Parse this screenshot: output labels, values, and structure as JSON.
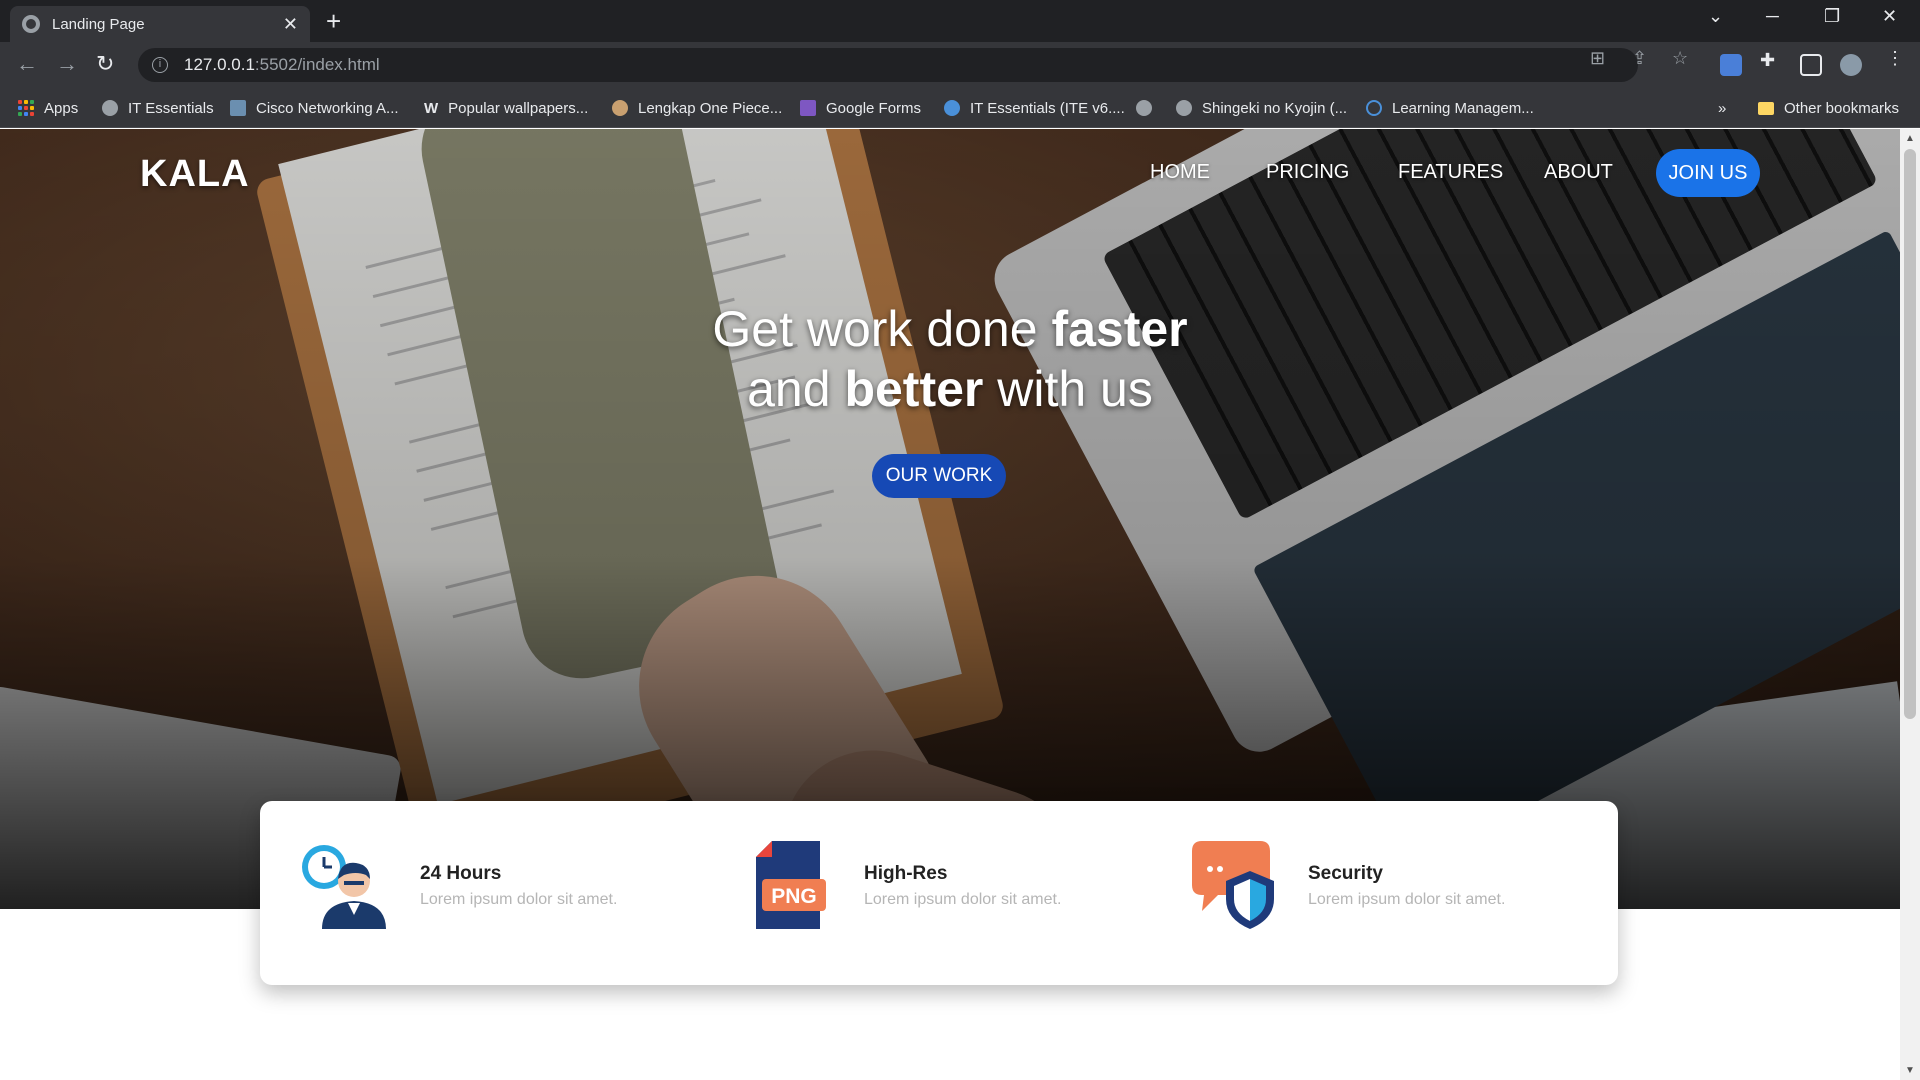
{
  "browser": {
    "tab_title": "Landing Page",
    "tab_close": "✕",
    "new_tab": "+",
    "url_host": "127.0.0.1",
    "url_path": ":5502/index.html",
    "bookmarks": [
      {
        "label": "Apps",
        "icon": "apps-grid-icon"
      },
      {
        "label": "IT Essentials",
        "icon": "globe-icon"
      },
      {
        "label": "Cisco Networking A...",
        "icon": "cisco-icon"
      },
      {
        "label": "Popular wallpapers...",
        "icon": "wikipedia-icon"
      },
      {
        "label": "Lengkap One Piece...",
        "icon": "site-icon"
      },
      {
        "label": "Google Forms",
        "icon": "forms-icon"
      },
      {
        "label": "IT Essentials (ITE v6....",
        "icon": "doc-icon"
      },
      {
        "label": "",
        "icon": "globe-icon"
      },
      {
        "label": "Shingeki no Kyojin (...",
        "icon": "globe-icon"
      },
      {
        "label": "Learning Managem...",
        "icon": "ring-icon"
      }
    ],
    "more_bookmarks": "»",
    "other_bookmarks": "Other bookmarks"
  },
  "page": {
    "logo": "KALA",
    "nav": [
      "HOME",
      "PRICING",
      "FEATURES",
      "ABOUT"
    ],
    "join_button": "JOIN US",
    "headline": {
      "line1_light": "Get work done ",
      "line1_bold": "faster",
      "line2_light_a": "and ",
      "line2_bold": "better",
      "line2_light_b": " with us"
    },
    "cta_button": "OUR WORK",
    "features": [
      {
        "title": "24 Hours",
        "desc": "Lorem ipsum dolor sit amet.",
        "icon": "clock-person-icon"
      },
      {
        "title": "High-Res",
        "desc": "Lorem ipsum dolor sit amet.",
        "icon": "png-file-icon",
        "icon_text": "PNG"
      },
      {
        "title": "Security",
        "desc": "Lorem ipsum dolor sit amet.",
        "icon": "shield-chat-icon"
      }
    ]
  },
  "colors": {
    "accent_blue": "#1a73e8",
    "cta_blue": "#1649b5",
    "card_text": "#222222",
    "desc_gray": "#b5b5b5"
  }
}
